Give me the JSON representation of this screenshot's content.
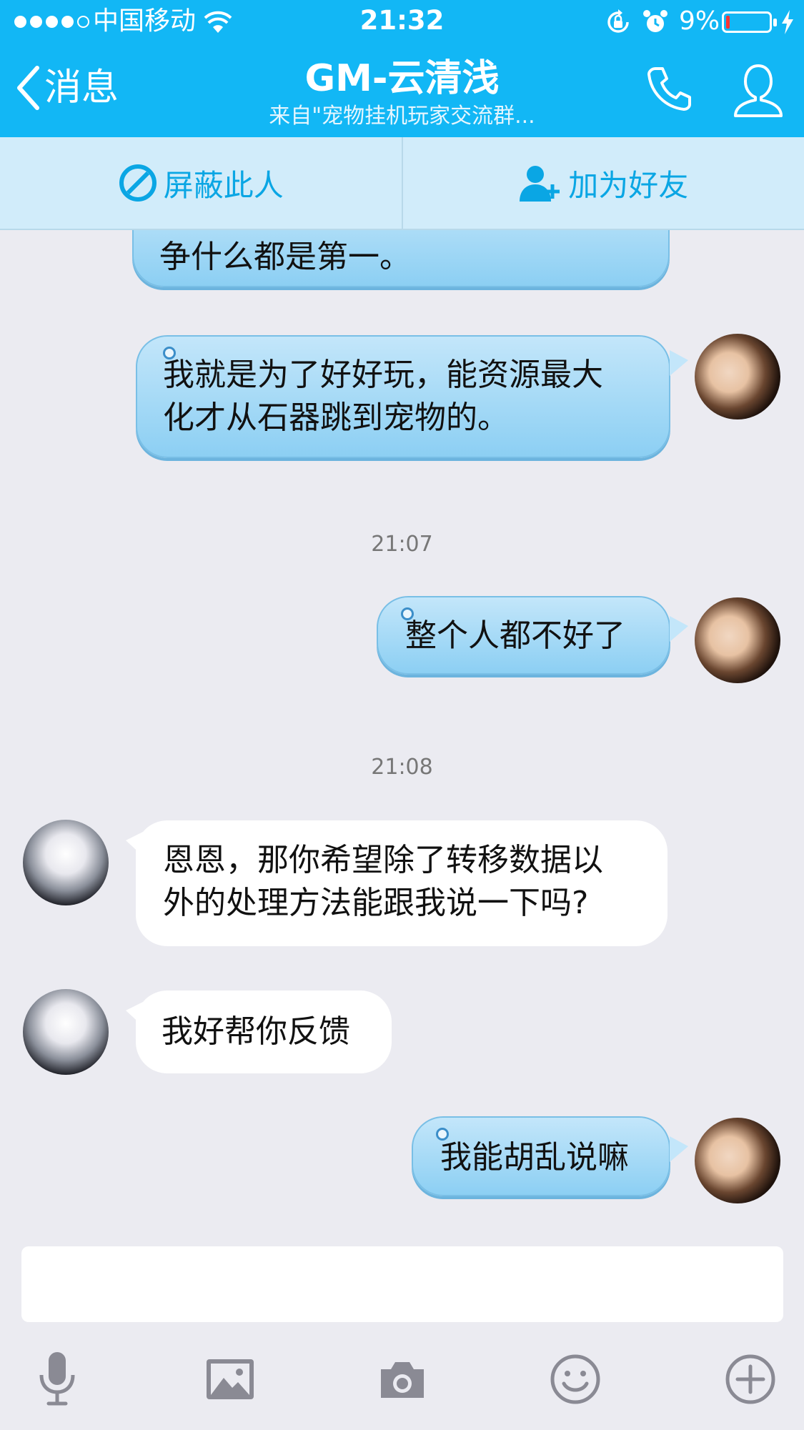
{
  "status_bar": {
    "carrier": "中国移动",
    "time": "21:32",
    "battery": "9%",
    "battery_level": 0.09
  },
  "nav": {
    "back_label": "消息",
    "title": "GM-云清浅",
    "subtitle": "来自\"宠物挂机玩家交流群..."
  },
  "actions": {
    "block_label": "屏蔽此人",
    "add_friend_label": "加为好友"
  },
  "messages": [
    {
      "side": "me",
      "lines": [
        "争什么都是第一。"
      ]
    },
    {
      "side": "me",
      "lines": [
        "我就是为了好好玩，能资源最大",
        "化才从石器跳到宠物的。"
      ]
    },
    {
      "type": "time",
      "text": "21:07"
    },
    {
      "side": "me",
      "lines": [
        "整个人都不好了"
      ]
    },
    {
      "type": "time",
      "text": "21:08"
    },
    {
      "side": "them",
      "lines": [
        "恩恩，那你希望除了转移数据以",
        "外的处理方法能跟我说一下吗?"
      ]
    },
    {
      "side": "them",
      "lines": [
        "我好帮你反馈"
      ]
    },
    {
      "side": "me",
      "lines": [
        "我能胡乱说嘛"
      ]
    }
  ],
  "input": {
    "value": "",
    "placeholder": ""
  },
  "toolbar": [
    "microphone-icon",
    "image-icon",
    "camera-icon",
    "emoji-icon",
    "plus-icon"
  ],
  "colors": {
    "header_bg": "#12b7f5",
    "action_bar_bg": "#d1ecfa",
    "action_text": "#0aa6e4",
    "chat_bg": "#ebebf1",
    "bubble_out": "#a6dbf7",
    "bubble_in": "#ffffff"
  }
}
